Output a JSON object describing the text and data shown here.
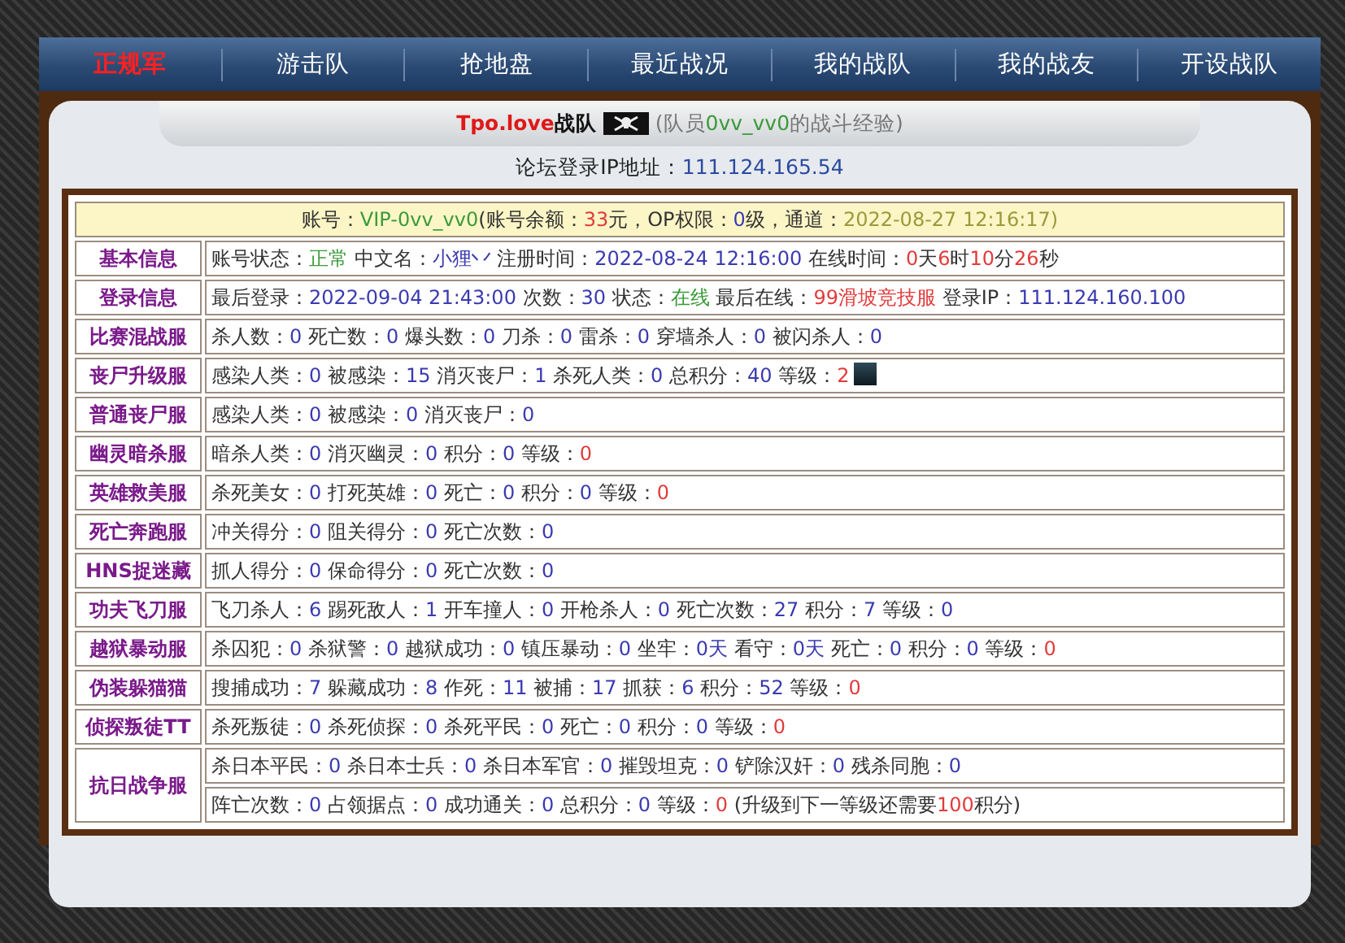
{
  "nav": [
    {
      "label": "正规军",
      "selected": true
    },
    {
      "label": "游击队",
      "selected": false
    },
    {
      "label": "抢地盘",
      "selected": false
    },
    {
      "label": "最近战况",
      "selected": false
    },
    {
      "label": "我的战队",
      "selected": false
    },
    {
      "label": "我的战友",
      "selected": false
    },
    {
      "label": "开设战队",
      "selected": false
    }
  ],
  "team_title": {
    "team": "Tpo.love",
    "suffix": "战队",
    "note_parts": [
      {
        "text": "(队员",
        "kind": "muted"
      },
      {
        "text": "0vv_vv0",
        "kind": "ok"
      },
      {
        "text": "的战斗经验)",
        "kind": "muted"
      }
    ]
  },
  "forum_ip": {
    "label": "论坛登录IP地址：",
    "value": "111.124.165.54"
  },
  "account_bar": [
    {
      "text": "账号：",
      "kind": "label"
    },
    {
      "text": "VIP-0vv_vv0",
      "kind": "ok"
    },
    {
      "text": "(账号余额：",
      "kind": "label"
    },
    {
      "text": "33",
      "kind": "alert"
    },
    {
      "text": "元，OP权限：",
      "kind": "label"
    },
    {
      "text": "0",
      "kind": "value"
    },
    {
      "text": "级，通道：",
      "kind": "label"
    },
    {
      "text": "2022-08-27 12:16:17)",
      "kind": "date"
    }
  ],
  "sections": [
    {
      "label": "基本信息",
      "lines": [
        [
          {
            "text": "账号状态：",
            "kind": "label"
          },
          {
            "text": "正常",
            "kind": "ok"
          },
          {
            "text": " 中文名：",
            "kind": "label"
          },
          {
            "text": "小狸丷",
            "kind": "value"
          },
          {
            "text": " 注册时间：",
            "kind": "label"
          },
          {
            "text": "2022-08-24 12:16:00",
            "kind": "value"
          },
          {
            "text": " 在线时间：",
            "kind": "label"
          },
          {
            "text": "0",
            "kind": "alert"
          },
          {
            "text": "天",
            "kind": "label"
          },
          {
            "text": "6",
            "kind": "alert"
          },
          {
            "text": "时",
            "kind": "label"
          },
          {
            "text": "10",
            "kind": "alert"
          },
          {
            "text": "分",
            "kind": "label"
          },
          {
            "text": "26",
            "kind": "alert"
          },
          {
            "text": "秒",
            "kind": "label"
          }
        ]
      ]
    },
    {
      "label": "登录信息",
      "lines": [
        [
          {
            "text": "最后登录：",
            "kind": "label"
          },
          {
            "text": "2022-09-04 21:43:00",
            "kind": "value"
          },
          {
            "text": " 次数：",
            "kind": "label"
          },
          {
            "text": "30",
            "kind": "value"
          },
          {
            "text": " 状态：",
            "kind": "label"
          },
          {
            "text": "在线",
            "kind": "ok"
          },
          {
            "text": " 最后在线：",
            "kind": "label"
          },
          {
            "text": "99滑坡竞技服",
            "kind": "alert"
          },
          {
            "text": " 登录IP：",
            "kind": "label"
          },
          {
            "text": "111.124.160.100",
            "kind": "value"
          }
        ]
      ]
    },
    {
      "label": "比赛混战服",
      "lines": [
        [
          {
            "text": "杀人数：",
            "kind": "label"
          },
          {
            "text": "0",
            "kind": "value"
          },
          {
            "text": " 死亡数：",
            "kind": "label"
          },
          {
            "text": "0",
            "kind": "value"
          },
          {
            "text": " 爆头数：",
            "kind": "label"
          },
          {
            "text": "0",
            "kind": "value"
          },
          {
            "text": " 刀杀：",
            "kind": "label"
          },
          {
            "text": "0",
            "kind": "value"
          },
          {
            "text": " 雷杀：",
            "kind": "label"
          },
          {
            "text": "0",
            "kind": "value"
          },
          {
            "text": " 穿墙杀人：",
            "kind": "label"
          },
          {
            "text": "0",
            "kind": "value"
          },
          {
            "text": " 被闪杀人：",
            "kind": "label"
          },
          {
            "text": "0",
            "kind": "value"
          }
        ]
      ]
    },
    {
      "label": "丧尸升级服",
      "avatar": true,
      "lines": [
        [
          {
            "text": "感染人类：",
            "kind": "label"
          },
          {
            "text": "0",
            "kind": "value"
          },
          {
            "text": " 被感染：",
            "kind": "label"
          },
          {
            "text": "15",
            "kind": "value"
          },
          {
            "text": " 消灭丧尸：",
            "kind": "label"
          },
          {
            "text": "1",
            "kind": "value"
          },
          {
            "text": " 杀死人类：",
            "kind": "label"
          },
          {
            "text": "0",
            "kind": "value"
          },
          {
            "text": " 总积分：",
            "kind": "label"
          },
          {
            "text": "40",
            "kind": "value"
          },
          {
            "text": " 等级：",
            "kind": "label"
          },
          {
            "text": "2",
            "kind": "alert"
          }
        ]
      ]
    },
    {
      "label": "普通丧尸服",
      "lines": [
        [
          {
            "text": "感染人类：",
            "kind": "label"
          },
          {
            "text": "0",
            "kind": "value"
          },
          {
            "text": " 被感染：",
            "kind": "label"
          },
          {
            "text": "0",
            "kind": "value"
          },
          {
            "text": " 消灭丧尸：",
            "kind": "label"
          },
          {
            "text": "0",
            "kind": "value"
          }
        ]
      ]
    },
    {
      "label": "幽灵暗杀服",
      "lines": [
        [
          {
            "text": "暗杀人类：",
            "kind": "label"
          },
          {
            "text": "0",
            "kind": "value"
          },
          {
            "text": " 消灭幽灵：",
            "kind": "label"
          },
          {
            "text": "0",
            "kind": "value"
          },
          {
            "text": " 积分：",
            "kind": "label"
          },
          {
            "text": "0",
            "kind": "value"
          },
          {
            "text": " 等级：",
            "kind": "label"
          },
          {
            "text": "0",
            "kind": "alert"
          }
        ]
      ]
    },
    {
      "label": "英雄救美服",
      "lines": [
        [
          {
            "text": "杀死美女：",
            "kind": "label"
          },
          {
            "text": "0",
            "kind": "value"
          },
          {
            "text": " 打死英雄：",
            "kind": "label"
          },
          {
            "text": "0",
            "kind": "value"
          },
          {
            "text": " 死亡：",
            "kind": "label"
          },
          {
            "text": "0",
            "kind": "value"
          },
          {
            "text": " 积分：",
            "kind": "label"
          },
          {
            "text": "0",
            "kind": "value"
          },
          {
            "text": " 等级：",
            "kind": "label"
          },
          {
            "text": "0",
            "kind": "alert"
          }
        ]
      ]
    },
    {
      "label": "死亡奔跑服",
      "lines": [
        [
          {
            "text": "冲关得分：",
            "kind": "label"
          },
          {
            "text": "0",
            "kind": "value"
          },
          {
            "text": " 阻关得分：",
            "kind": "label"
          },
          {
            "text": "0",
            "kind": "value"
          },
          {
            "text": " 死亡次数：",
            "kind": "label"
          },
          {
            "text": "0",
            "kind": "value"
          }
        ]
      ]
    },
    {
      "label": "HNS捉迷藏",
      "lines": [
        [
          {
            "text": "抓人得分：",
            "kind": "label"
          },
          {
            "text": "0",
            "kind": "value"
          },
          {
            "text": " 保命得分：",
            "kind": "label"
          },
          {
            "text": "0",
            "kind": "value"
          },
          {
            "text": " 死亡次数：",
            "kind": "label"
          },
          {
            "text": "0",
            "kind": "value"
          }
        ]
      ]
    },
    {
      "label": "功夫飞刀服",
      "lines": [
        [
          {
            "text": "飞刀杀人：",
            "kind": "label"
          },
          {
            "text": "6",
            "kind": "value"
          },
          {
            "text": " 踢死敌人：",
            "kind": "label"
          },
          {
            "text": "1",
            "kind": "value"
          },
          {
            "text": " 开车撞人：",
            "kind": "label"
          },
          {
            "text": "0",
            "kind": "value"
          },
          {
            "text": " 开枪杀人：",
            "kind": "label"
          },
          {
            "text": "0",
            "kind": "value"
          },
          {
            "text": " 死亡次数：",
            "kind": "label"
          },
          {
            "text": "27",
            "kind": "value"
          },
          {
            "text": " 积分：",
            "kind": "label"
          },
          {
            "text": "7",
            "kind": "value"
          },
          {
            "text": " 等级：",
            "kind": "label"
          },
          {
            "text": "0",
            "kind": "value"
          }
        ]
      ]
    },
    {
      "label": "越狱暴动服",
      "lines": [
        [
          {
            "text": "杀囚犯：",
            "kind": "label"
          },
          {
            "text": "0",
            "kind": "value"
          },
          {
            "text": " 杀狱警：",
            "kind": "label"
          },
          {
            "text": "0",
            "kind": "value"
          },
          {
            "text": " 越狱成功：",
            "kind": "label"
          },
          {
            "text": "0",
            "kind": "value"
          },
          {
            "text": " 镇压暴动：",
            "kind": "label"
          },
          {
            "text": "0",
            "kind": "value"
          },
          {
            "text": " 坐牢：",
            "kind": "label"
          },
          {
            "text": "0天",
            "kind": "value"
          },
          {
            "text": " 看守：",
            "kind": "label"
          },
          {
            "text": "0天",
            "kind": "value"
          },
          {
            "text": " 死亡：",
            "kind": "label"
          },
          {
            "text": "0",
            "kind": "value"
          },
          {
            "text": " 积分：",
            "kind": "label"
          },
          {
            "text": "0",
            "kind": "value"
          },
          {
            "text": " 等级：",
            "kind": "label"
          },
          {
            "text": "0",
            "kind": "alert"
          }
        ]
      ]
    },
    {
      "label": "伪装躲猫猫",
      "lines": [
        [
          {
            "text": "搜捕成功：",
            "kind": "label"
          },
          {
            "text": "7",
            "kind": "value"
          },
          {
            "text": " 躲藏成功：",
            "kind": "label"
          },
          {
            "text": "8",
            "kind": "value"
          },
          {
            "text": " 作死：",
            "kind": "label"
          },
          {
            "text": "11",
            "kind": "value"
          },
          {
            "text": " 被捕：",
            "kind": "label"
          },
          {
            "text": "17",
            "kind": "value"
          },
          {
            "text": " 抓获：",
            "kind": "label"
          },
          {
            "text": "6",
            "kind": "value"
          },
          {
            "text": " 积分：",
            "kind": "label"
          },
          {
            "text": "52",
            "kind": "value"
          },
          {
            "text": " 等级：",
            "kind": "label"
          },
          {
            "text": "0",
            "kind": "alert"
          }
        ]
      ]
    },
    {
      "label": "侦探叛徒TT",
      "lines": [
        [
          {
            "text": "杀死叛徒：",
            "kind": "label"
          },
          {
            "text": "0",
            "kind": "value"
          },
          {
            "text": " 杀死侦探：",
            "kind": "label"
          },
          {
            "text": "0",
            "kind": "value"
          },
          {
            "text": " 杀死平民：",
            "kind": "label"
          },
          {
            "text": "0",
            "kind": "value"
          },
          {
            "text": " 死亡：",
            "kind": "label"
          },
          {
            "text": "0",
            "kind": "value"
          },
          {
            "text": " 积分：",
            "kind": "label"
          },
          {
            "text": "0",
            "kind": "value"
          },
          {
            "text": " 等级：",
            "kind": "label"
          },
          {
            "text": "0",
            "kind": "alert"
          }
        ]
      ]
    },
    {
      "label": "抗日战争服",
      "lines": [
        [
          {
            "text": "杀日本平民：",
            "kind": "label"
          },
          {
            "text": "0",
            "kind": "value"
          },
          {
            "text": " 杀日本士兵：",
            "kind": "label"
          },
          {
            "text": "0",
            "kind": "value"
          },
          {
            "text": " 杀日本军官：",
            "kind": "label"
          },
          {
            "text": "0",
            "kind": "value"
          },
          {
            "text": " 摧毁坦克：",
            "kind": "label"
          },
          {
            "text": "0",
            "kind": "value"
          },
          {
            "text": " 铲除汉奸：",
            "kind": "label"
          },
          {
            "text": "0",
            "kind": "value"
          },
          {
            "text": " 残杀同胞：",
            "kind": "label"
          },
          {
            "text": "0",
            "kind": "value"
          }
        ],
        [
          {
            "text": "阵亡次数：",
            "kind": "label"
          },
          {
            "text": "0",
            "kind": "value"
          },
          {
            "text": " 占领据点：",
            "kind": "label"
          },
          {
            "text": "0",
            "kind": "value"
          },
          {
            "text": " 成功通关：",
            "kind": "label"
          },
          {
            "text": "0",
            "kind": "value"
          },
          {
            "text": " 总积分：",
            "kind": "label"
          },
          {
            "text": "0",
            "kind": "value"
          },
          {
            "text": " 等级：",
            "kind": "label"
          },
          {
            "text": "0",
            "kind": "alert"
          },
          {
            "text": " (升级到下一等级还需要",
            "kind": "label"
          },
          {
            "text": "100",
            "kind": "alert"
          },
          {
            "text": "积分)",
            "kind": "label"
          }
        ]
      ]
    }
  ]
}
